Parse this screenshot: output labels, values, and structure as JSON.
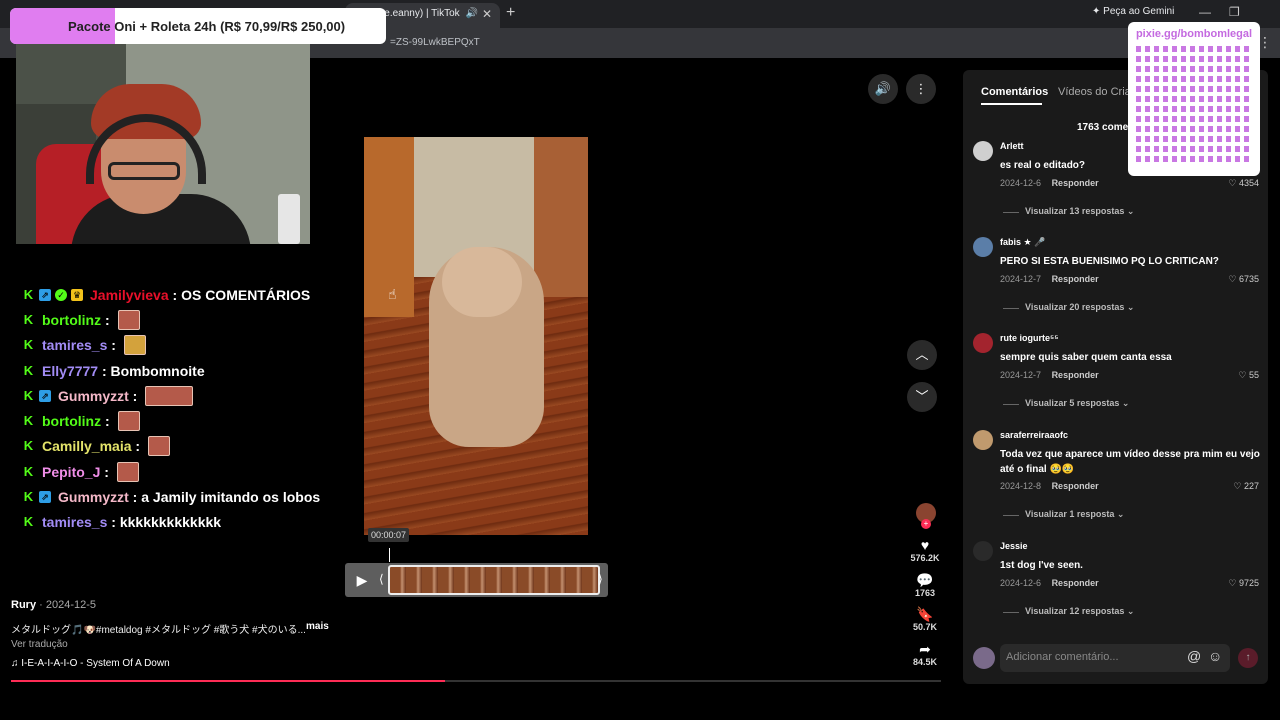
{
  "browser": {
    "tab_title": "z (@e.eanny) | TikTok",
    "new_tab": "+",
    "gemini": "Peça ao Gemini",
    "url": "=ZS-99LwkBEPQxT"
  },
  "overlay": {
    "promo": "Pacote Oni + Roleta 24h (R$ 70,99/R$ 250,00)",
    "qr_url": "pixie.gg/bombomlegal"
  },
  "chat": [
    {
      "user": "Jamilyvieva",
      "color": "#e8102a",
      "badges": [
        "k",
        "s",
        "v",
        "c"
      ],
      "message": "OS COMENTÁRIOS",
      "emote": ""
    },
    {
      "user": "bortolinz",
      "color": "#53fc18",
      "badges": [
        "k"
      ],
      "message": "",
      "emote": "face"
    },
    {
      "user": "tamires_s",
      "color": "#a28cf5",
      "badges": [
        "k"
      ],
      "message": "",
      "emote": "yellow"
    },
    {
      "user": "Elly7777",
      "color": "#a28cf5",
      "badges": [
        "k"
      ],
      "message": "Bombomnoite",
      "emote": ""
    },
    {
      "user": "Gummyzzt",
      "color": "#f4b8c8",
      "badges": [
        "k",
        "s"
      ],
      "message": "",
      "emote": "wide"
    },
    {
      "user": "bortolinz",
      "color": "#53fc18",
      "badges": [
        "k"
      ],
      "message": "",
      "emote": "face"
    },
    {
      "user": "Camilly_maia",
      "color": "#e3e36a",
      "badges": [
        "k"
      ],
      "message": "",
      "emote": "face"
    },
    {
      "user": "Pepito_J",
      "color": "#f08ee8",
      "badges": [
        "k"
      ],
      "message": "",
      "emote": "face"
    },
    {
      "user": "Gummyzzt",
      "color": "#f4b8c8",
      "badges": [
        "k",
        "s"
      ],
      "message": "a Jamily imitando os lobos",
      "emote": ""
    },
    {
      "user": "tamires_s",
      "color": "#a28cf5",
      "badges": [
        "k"
      ],
      "message": "kkkkkkkkkkkkk",
      "emote": ""
    }
  ],
  "player": {
    "timestamp": "00:00:07",
    "progress_fraction": 0.467
  },
  "actions": {
    "likes": "576.2K",
    "comments": "1763",
    "saves": "50.7K",
    "shares": "84.5K"
  },
  "video_info": {
    "author": "Rury",
    "date": "· 2024-12-5",
    "description": "メタルドッグ🎵🐶#metaldog #メタルドッグ #歌う犬 #犬のいる...",
    "more": "mais",
    "translate": "Ver tradução",
    "music": "♫  I-E-A-I-A-I-O - System Of A Down"
  },
  "panel": {
    "tab_comments": "Comentários",
    "tab_videos": "Vídeos do Cria",
    "count": "1763 comen",
    "add_placeholder": "Adicionar comentário..."
  },
  "comments": [
    {
      "name": "Arlett",
      "text": "es real o editado?",
      "date": "2024-12-6",
      "reply": "Responder",
      "likes": "4354",
      "view": "Visualizar 13 respostas ⌄",
      "avatar": "#cfcfcf"
    },
    {
      "name": "fabis ★ 🎤",
      "text": "PERO SI ESTA BUENISIMO PQ LO CRITICAN?",
      "date": "2024-12-7",
      "reply": "Responder",
      "likes": "6735",
      "view": "Visualizar 20 respostas ⌄",
      "avatar": "#5b7ea8"
    },
    {
      "name": "rute iogurte⁵⁵",
      "text": "sempre quis saber quem canta essa",
      "date": "2024-12-7",
      "reply": "Responder",
      "likes": "55",
      "view": "Visualizar 5 respostas ⌄",
      "avatar": "#a3242e"
    },
    {
      "name": "saraferreiraaofc",
      "text": "Toda vez que aparece um vídeo desse pra mim eu vejo até o final 🥹🥹",
      "date": "2024-12-8",
      "reply": "Responder",
      "likes": "227",
      "view": "Visualizar 1 resposta ⌄",
      "avatar": "#c09a6e"
    },
    {
      "name": "Jessie",
      "text": "1st dog I've seen.",
      "date": "2024-12-6",
      "reply": "Responder",
      "likes": "9725",
      "view": "Visualizar 12 respostas ⌄",
      "avatar": "#2a2a2a"
    }
  ]
}
